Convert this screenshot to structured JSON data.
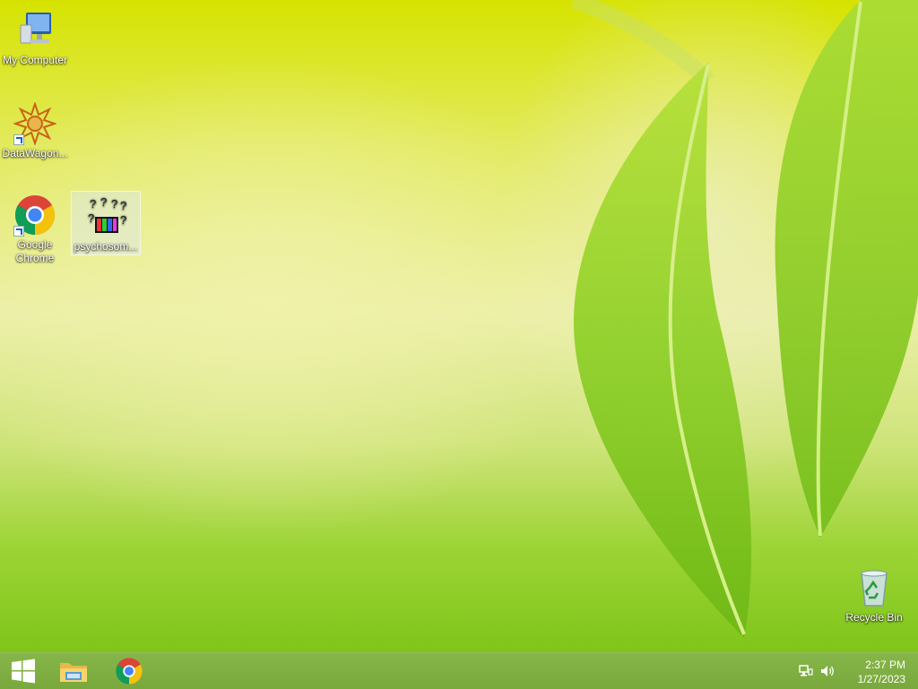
{
  "desktop": {
    "icons": [
      {
        "label": "My Computer",
        "icon": "computer-icon"
      },
      {
        "label": "DataWagon...",
        "icon": "datawagon-icon"
      },
      {
        "label": "Google Chrome",
        "icon": "chrome-icon"
      },
      {
        "label": "psychosom...",
        "icon": "unknown-file-icon"
      },
      {
        "label": "Recycle Bin",
        "icon": "recycle-bin-icon"
      }
    ]
  },
  "taskbar": {
    "start_icon": "windows-logo-icon",
    "pinned": [
      {
        "name": "File Explorer",
        "icon": "file-explorer-icon"
      },
      {
        "name": "Google Chrome",
        "icon": "chrome-icon"
      }
    ],
    "tray": {
      "network_icon": "network-icon",
      "volume_icon": "volume-icon",
      "time": "2:37 PM",
      "date": "1/27/2023"
    }
  },
  "colors": {
    "taskbar": "#7eae42",
    "wallpaper_top": "#d6e300",
    "wallpaper_bottom": "#7fc51a"
  }
}
